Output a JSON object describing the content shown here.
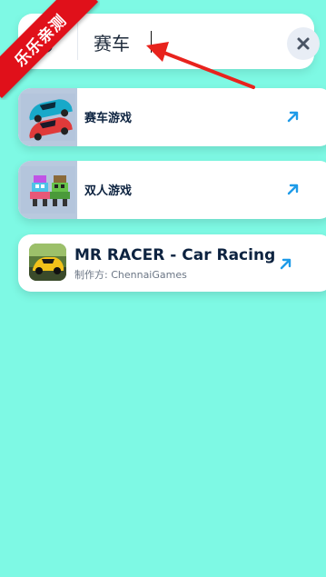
{
  "ribbon": {
    "text": "乐乐亲测",
    "color": "#e0101a"
  },
  "search": {
    "query": "赛车",
    "clear_icon": "close-icon"
  },
  "results": [
    {
      "label": "赛车游戏",
      "thumb_icon": "race-cars-image"
    },
    {
      "label": "双人游戏",
      "thumb_icon": "pixel-characters-image"
    }
  ],
  "app_result": {
    "title": "MR RACER - Car Racing",
    "developer": "制作方: ChennaiGames",
    "icon": "mr-racer-app-icon"
  },
  "colors": {
    "background": "#7ef9e4",
    "accent_blue": "#1e9be8",
    "text_dark": "#0d2340",
    "annotation_red": "#e8231d"
  }
}
